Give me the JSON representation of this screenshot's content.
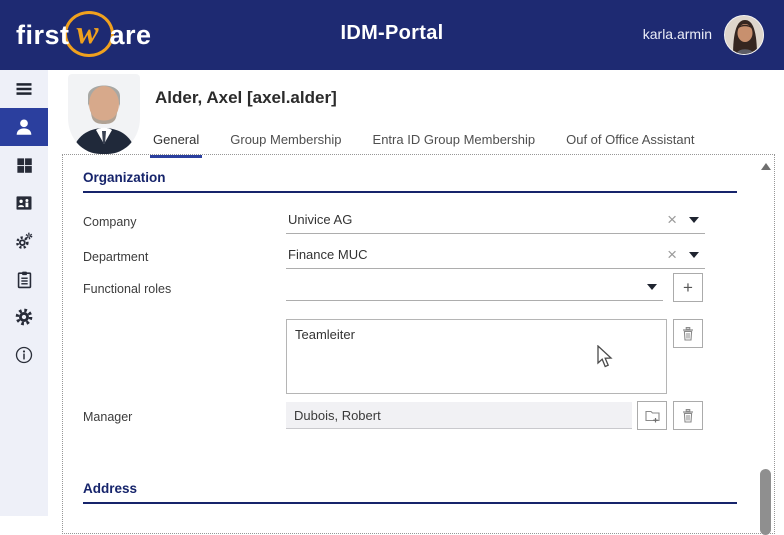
{
  "header": {
    "logo": {
      "part1": "first",
      "part2": "w",
      "part3": "are"
    },
    "title": "IDM-Portal",
    "username": "karla.armin"
  },
  "sidebar": {
    "icons": [
      "hamburger-menu",
      "user-profile",
      "apps-grid",
      "org-directory",
      "services-gears",
      "tasks-clipboard",
      "settings-gear",
      "info"
    ]
  },
  "user_header": {
    "display_name": "Alder, Axel [axel.alder]"
  },
  "tabs": {
    "items": [
      {
        "label": "General",
        "active": true
      },
      {
        "label": "Group Membership",
        "active": false
      },
      {
        "label": "Entra ID Group Membership",
        "active": false
      },
      {
        "label": "Ouf of Office Assistant",
        "active": false
      }
    ]
  },
  "form": {
    "organization": {
      "heading": "Organization",
      "company_label": "Company",
      "company_value": "Univice AG",
      "department_label": "Department",
      "department_value": "Finance MUC",
      "functional_roles_label": "Functional roles",
      "functional_roles_selected": "",
      "functional_roles_assigned": [
        "Teamleiter"
      ],
      "manager_label": "Manager",
      "manager_value": "Dubois, Robert"
    },
    "address": {
      "heading": "Address"
    }
  },
  "icons": {
    "clear": "×",
    "add": "+"
  },
  "colors": {
    "header_bg": "#1e2a72",
    "logo_accent": "#f0a11e",
    "nav_active_bg": "#2b3f9e",
    "section_heading": "#16246b",
    "tab_active_underline": "#2b3f9e"
  }
}
